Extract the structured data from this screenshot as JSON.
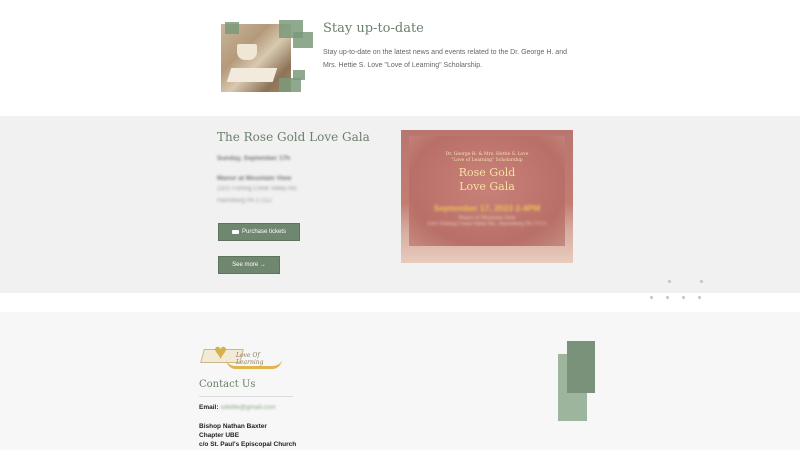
{
  "top": {
    "title": "Stay up-to-date",
    "text": "Stay up-to-date on the latest news and events related to the Dr. George H. and Mrs. Hettie S. Love \"Love of Learning\" Scholarship."
  },
  "gala": {
    "title": "The Rose Gold Love Gala",
    "date": "Sunday, September 17h",
    "venue": "Manor at Mountain View",
    "address_line1": "2201 Fishing Creek Valley Rd.",
    "address_line2": "Harrisburg PA 17112",
    "purchase_label": "Purchase tickets",
    "see_more_label": "See more →",
    "poster": {
      "line1": "Dr. George H. & Mrs. Hettie S. Love",
      "line2": "\"Love of Learning\" Scholarship",
      "title1": "Rose Gold",
      "title2": "Love Gala",
      "date": "September 17, 2023 2-4PM",
      "venue": "Manor at Mountain View",
      "address": "2201 Fishing Creek Valley Rd., Harrisburg PA 17112"
    }
  },
  "footer": {
    "logo_text": "Love Of Learning",
    "contact_title": "Contact Us",
    "email_label": "Email:",
    "email_value": "sdettle@gmail.com",
    "address": [
      "Bishop Nathan Baxter",
      "Chapter UBE",
      "c/o St. Paul's Episcopal Church"
    ]
  },
  "colors": {
    "accent": "#6f866f",
    "gala_bg": "#f1f1f1",
    "footer_bg": "#f7f7f7"
  }
}
